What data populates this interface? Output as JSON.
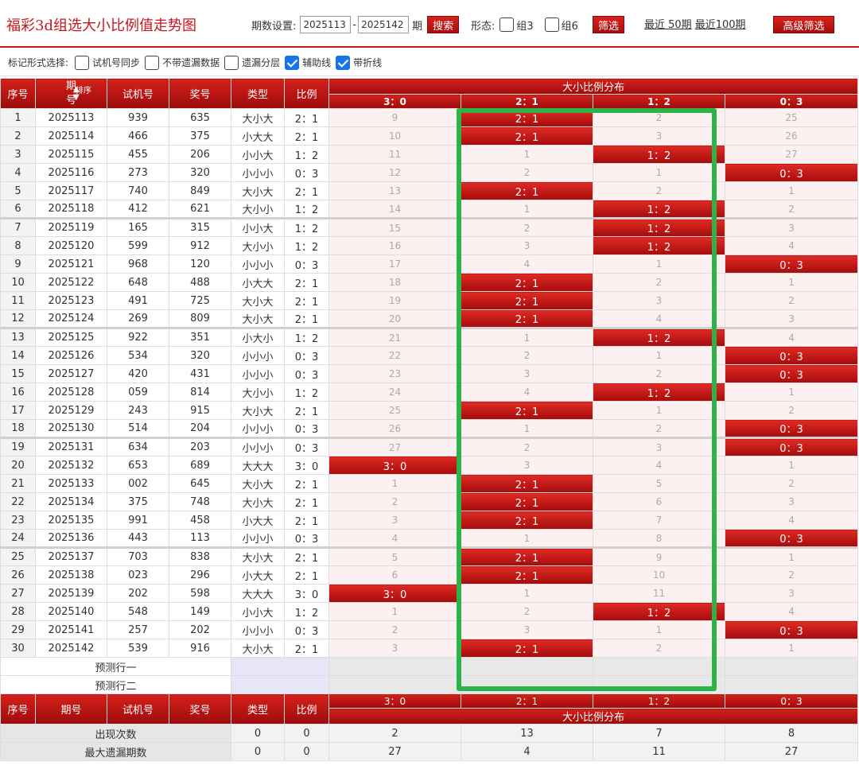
{
  "header": {
    "title": "福彩3d组选大小比例值走势图",
    "period_label": "期数设置:",
    "period_from": "2025113",
    "dash": "-",
    "period_to": "2025142",
    "period_unit": "期",
    "search_button": "搜索",
    "shape_label": "形态:",
    "group3_label": "组3",
    "group6_label": "组6",
    "filter_button": "筛选",
    "recent50": "最近 50期",
    "recent100": "最近100期",
    "advanced_button": "高级筛选"
  },
  "markbar": {
    "label": "标记形式选择:",
    "options": [
      {
        "label": "试机号同步",
        "checked": false
      },
      {
        "label": "不带遗漏数据",
        "checked": false
      },
      {
        "label": "遗漏分层",
        "checked": false
      },
      {
        "label": "辅助线",
        "checked": true
      },
      {
        "label": "带折线",
        "checked": true
      }
    ]
  },
  "table": {
    "headers": {
      "idx": "序号",
      "period": "期号",
      "sort": "排序",
      "test": "试机号",
      "prize": "奖号",
      "type": "类型",
      "ratio": "比例",
      "dist": "大小比例分布"
    },
    "dist_cols": [
      "3：0",
      "2：1",
      "1：2",
      "0：3"
    ],
    "rows": [
      {
        "i": "1",
        "p": "2025113",
        "t": "939",
        "n": "635",
        "k": "大小大",
        "r": "2：1",
        "d": [
          "9",
          "2：1",
          "2",
          "25"
        ],
        "h": 1
      },
      {
        "i": "2",
        "p": "2025114",
        "t": "466",
        "n": "375",
        "k": "小大大",
        "r": "2：1",
        "d": [
          "10",
          "2：1",
          "3",
          "26"
        ],
        "h": 1
      },
      {
        "i": "3",
        "p": "2025115",
        "t": "455",
        "n": "206",
        "k": "小小大",
        "r": "1：2",
        "d": [
          "11",
          "1",
          "1：2",
          "27"
        ],
        "h": 2
      },
      {
        "i": "4",
        "p": "2025116",
        "t": "273",
        "n": "320",
        "k": "小小小",
        "r": "0：3",
        "d": [
          "12",
          "2",
          "1",
          "0：3"
        ],
        "h": 3
      },
      {
        "i": "5",
        "p": "2025117",
        "t": "740",
        "n": "849",
        "k": "大小大",
        "r": "2：1",
        "d": [
          "13",
          "2：1",
          "2",
          "1"
        ],
        "h": 1
      },
      {
        "i": "6",
        "p": "2025118",
        "t": "412",
        "n": "621",
        "k": "大小小",
        "r": "1：2",
        "d": [
          "14",
          "1",
          "1：2",
          "2"
        ],
        "h": 2
      },
      {
        "i": "7",
        "p": "2025119",
        "t": "165",
        "n": "315",
        "k": "小小大",
        "r": "1：2",
        "d": [
          "15",
          "2",
          "1：2",
          "3"
        ],
        "h": 2
      },
      {
        "i": "8",
        "p": "2025120",
        "t": "599",
        "n": "912",
        "k": "大小小",
        "r": "1：2",
        "d": [
          "16",
          "3",
          "1：2",
          "4"
        ],
        "h": 2
      },
      {
        "i": "9",
        "p": "2025121",
        "t": "968",
        "n": "120",
        "k": "小小小",
        "r": "0：3",
        "d": [
          "17",
          "4",
          "1",
          "0：3"
        ],
        "h": 3
      },
      {
        "i": "10",
        "p": "2025122",
        "t": "648",
        "n": "488",
        "k": "小大大",
        "r": "2：1",
        "d": [
          "18",
          "2：1",
          "2",
          "1"
        ],
        "h": 1
      },
      {
        "i": "11",
        "p": "2025123",
        "t": "491",
        "n": "725",
        "k": "大小大",
        "r": "2：1",
        "d": [
          "19",
          "2：1",
          "3",
          "2"
        ],
        "h": 1
      },
      {
        "i": "12",
        "p": "2025124",
        "t": "269",
        "n": "809",
        "k": "大小大",
        "r": "2：1",
        "d": [
          "20",
          "2：1",
          "4",
          "3"
        ],
        "h": 1
      },
      {
        "i": "13",
        "p": "2025125",
        "t": "922",
        "n": "351",
        "k": "小大小",
        "r": "1：2",
        "d": [
          "21",
          "1",
          "1：2",
          "4"
        ],
        "h": 2
      },
      {
        "i": "14",
        "p": "2025126",
        "t": "534",
        "n": "320",
        "k": "小小小",
        "r": "0：3",
        "d": [
          "22",
          "2",
          "1",
          "0：3"
        ],
        "h": 3
      },
      {
        "i": "15",
        "p": "2025127",
        "t": "420",
        "n": "431",
        "k": "小小小",
        "r": "0：3",
        "d": [
          "23",
          "3",
          "2",
          "0：3"
        ],
        "h": 3
      },
      {
        "i": "16",
        "p": "2025128",
        "t": "059",
        "n": "814",
        "k": "大小小",
        "r": "1：2",
        "d": [
          "24",
          "4",
          "1：2",
          "1"
        ],
        "h": 2
      },
      {
        "i": "17",
        "p": "2025129",
        "t": "243",
        "n": "915",
        "k": "大小大",
        "r": "2：1",
        "d": [
          "25",
          "2：1",
          "1",
          "2"
        ],
        "h": 1
      },
      {
        "i": "18",
        "p": "2025130",
        "t": "514",
        "n": "204",
        "k": "小小小",
        "r": "0：3",
        "d": [
          "26",
          "1",
          "2",
          "0：3"
        ],
        "h": 3
      },
      {
        "i": "19",
        "p": "2025131",
        "t": "634",
        "n": "203",
        "k": "小小小",
        "r": "0：3",
        "d": [
          "27",
          "2",
          "3",
          "0：3"
        ],
        "h": 3
      },
      {
        "i": "20",
        "p": "2025132",
        "t": "653",
        "n": "689",
        "k": "大大大",
        "r": "3：0",
        "d": [
          "3：0",
          "3",
          "4",
          "1"
        ],
        "h": 0
      },
      {
        "i": "21",
        "p": "2025133",
        "t": "002",
        "n": "645",
        "k": "大小大",
        "r": "2：1",
        "d": [
          "1",
          "2：1",
          "5",
          "2"
        ],
        "h": 1
      },
      {
        "i": "22",
        "p": "2025134",
        "t": "375",
        "n": "748",
        "k": "大小大",
        "r": "2：1",
        "d": [
          "2",
          "2：1",
          "6",
          "3"
        ],
        "h": 1
      },
      {
        "i": "23",
        "p": "2025135",
        "t": "991",
        "n": "458",
        "k": "小大大",
        "r": "2：1",
        "d": [
          "3",
          "2：1",
          "7",
          "4"
        ],
        "h": 1
      },
      {
        "i": "24",
        "p": "2025136",
        "t": "443",
        "n": "113",
        "k": "小小小",
        "r": "0：3",
        "d": [
          "4",
          "1",
          "8",
          "0：3"
        ],
        "h": 3
      },
      {
        "i": "25",
        "p": "2025137",
        "t": "703",
        "n": "838",
        "k": "大小大",
        "r": "2：1",
        "d": [
          "5",
          "2：1",
          "9",
          "1"
        ],
        "h": 1
      },
      {
        "i": "26",
        "p": "2025138",
        "t": "023",
        "n": "296",
        "k": "小大大",
        "r": "2：1",
        "d": [
          "6",
          "2：1",
          "10",
          "2"
        ],
        "h": 1
      },
      {
        "i": "27",
        "p": "2025139",
        "t": "202",
        "n": "598",
        "k": "大大大",
        "r": "3：0",
        "d": [
          "3：0",
          "1",
          "11",
          "3"
        ],
        "h": 0
      },
      {
        "i": "28",
        "p": "2025140",
        "t": "548",
        "n": "149",
        "k": "小小大",
        "r": "1：2",
        "d": [
          "1",
          "2",
          "1：2",
          "4"
        ],
        "h": 2
      },
      {
        "i": "29",
        "p": "2025141",
        "t": "257",
        "n": "202",
        "k": "小小小",
        "r": "0：3",
        "d": [
          "2",
          "3",
          "1",
          "0：3"
        ],
        "h": 3
      },
      {
        "i": "30",
        "p": "2025142",
        "t": "539",
        "n": "916",
        "k": "大小大",
        "r": "2：1",
        "d": [
          "3",
          "2：1",
          "2",
          "1"
        ],
        "h": 1
      }
    ],
    "predict1": "预测行一",
    "predict2": "预测行二",
    "stats": [
      {
        "label": "出现次数",
        "type": "0",
        "ratio": "0",
        "vals": [
          "2",
          "13",
          "7",
          "8"
        ]
      },
      {
        "label": "最大遗漏期数",
        "type": "0",
        "ratio": "0",
        "vals": [
          "27",
          "4",
          "11",
          "27"
        ]
      }
    ]
  },
  "colors": {
    "accent": "#c81818",
    "highlight": "#2eb34a",
    "checkbox": "#1a73e8"
  }
}
